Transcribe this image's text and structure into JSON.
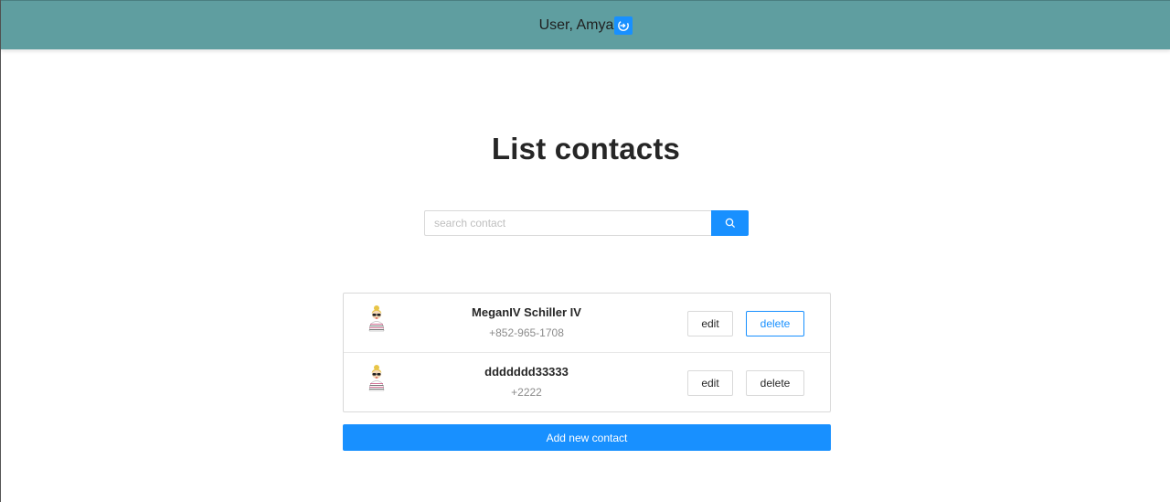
{
  "header": {
    "user_label": "User, Amya",
    "logout_icon": "logout-icon",
    "background": "#5f9ea0"
  },
  "page": {
    "title": "List contacts"
  },
  "search": {
    "placeholder": "search contact",
    "value": "",
    "button_icon": "search-icon"
  },
  "contacts": [
    {
      "name": "MeganIV Schiller IV",
      "phone": "+852-965-1708",
      "edit_label": "edit",
      "delete_label": "delete",
      "avatar_icon": "avatar-icon"
    },
    {
      "name": "ddddddd33333",
      "phone": "+2222",
      "edit_label": "edit",
      "delete_label": "delete",
      "avatar_icon": "avatar-icon"
    }
  ],
  "actions": {
    "add_label": "Add new contact"
  },
  "colors": {
    "accent": "#1890ff",
    "header": "#5f9ea0"
  }
}
